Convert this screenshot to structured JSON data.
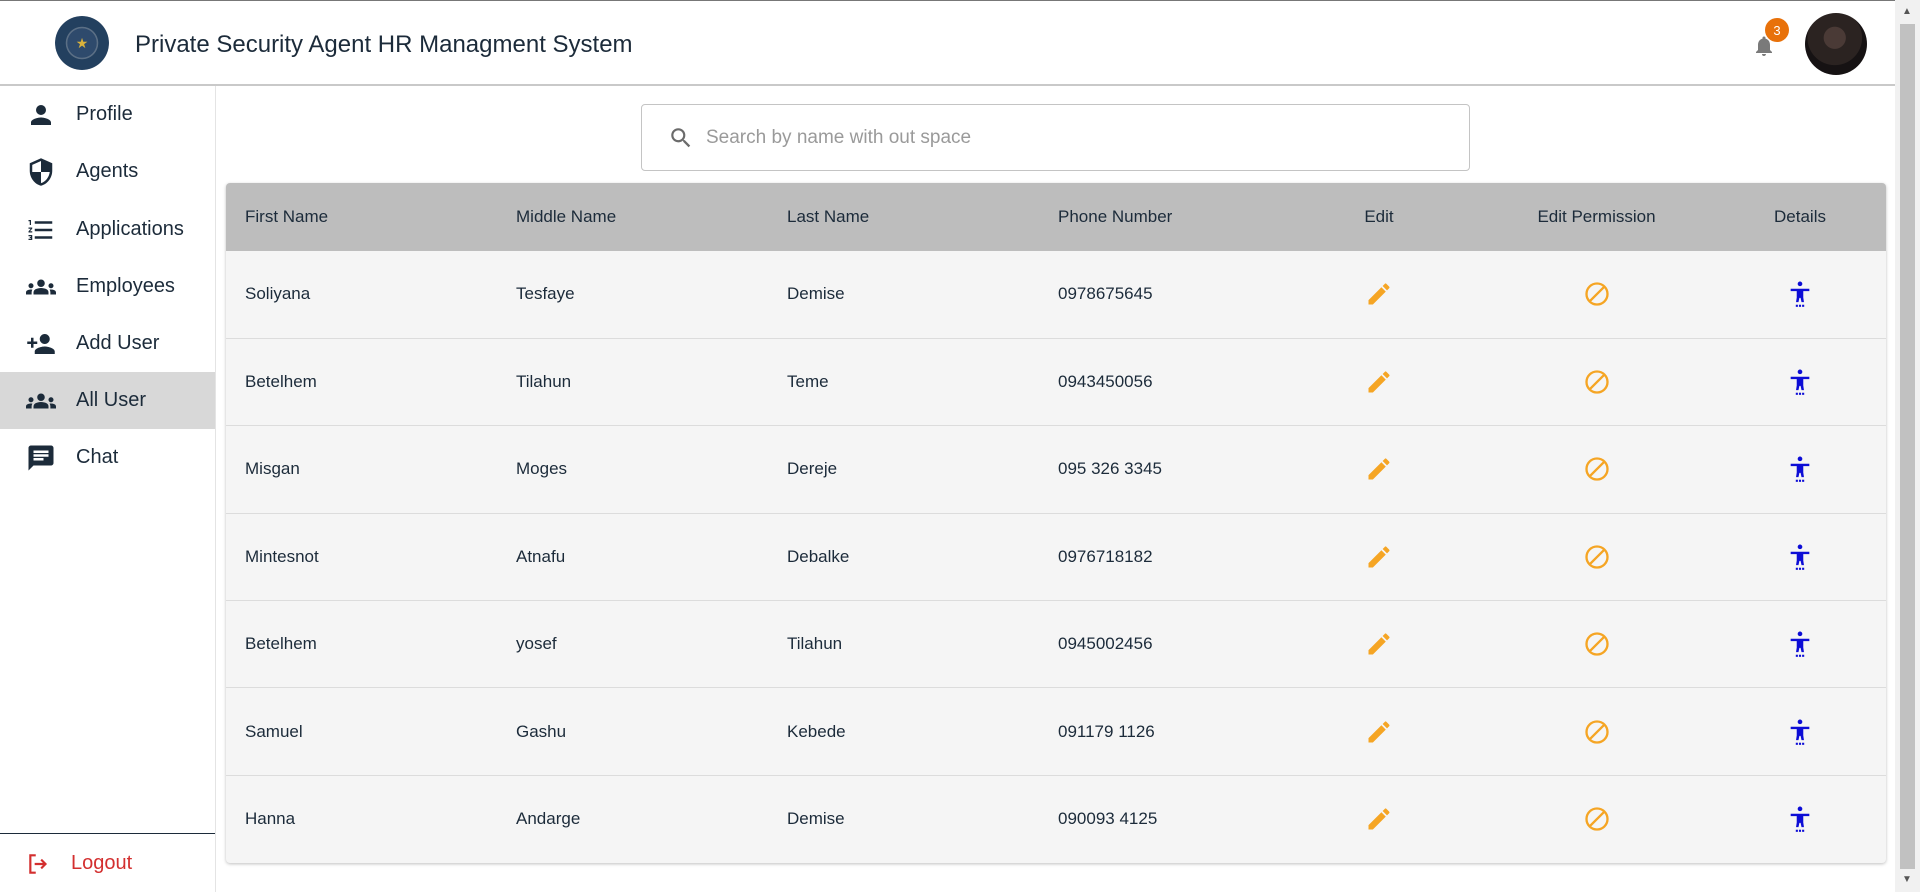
{
  "app": {
    "title": "Private Security Agent HR Managment System"
  },
  "header": {
    "notification_count": "3"
  },
  "sidebar": {
    "items": [
      {
        "label": "Profile",
        "icon": "person-icon"
      },
      {
        "label": "Agents",
        "icon": "shield-icon"
      },
      {
        "label": "Applications",
        "icon": "list-icon"
      },
      {
        "label": "Employees",
        "icon": "group-icon"
      },
      {
        "label": "Add User",
        "icon": "person-add-icon"
      },
      {
        "label": "All User",
        "icon": "group-icon",
        "active": true
      },
      {
        "label": "Chat",
        "icon": "chat-icon"
      }
    ],
    "logout_label": "Logout"
  },
  "search": {
    "placeholder": "Search by name with out space",
    "value": ""
  },
  "table": {
    "headers": [
      "First Name",
      "Middle Name",
      "Last Name",
      "Phone Number",
      "Edit",
      "Edit Permission",
      "Details"
    ],
    "rows": [
      {
        "first": "Soliyana",
        "middle": "Tesfaye",
        "last": "Demise",
        "phone": "0978675645"
      },
      {
        "first": "Betelhem",
        "middle": "Tilahun",
        "last": "Teme",
        "phone": "0943450056"
      },
      {
        "first": "Misgan",
        "middle": "Moges",
        "last": "Dereje",
        "phone": "095 326 3345"
      },
      {
        "first": "Mintesnot",
        "middle": "Atnafu",
        "last": "Debalke",
        "phone": "0976718182"
      },
      {
        "first": "Betelhem",
        "middle": "yosef",
        "last": "Tilahun",
        "phone": "0945002456"
      },
      {
        "first": "Samuel",
        "middle": "Gashu",
        "last": "Kebede",
        "phone": "091179 1126"
      },
      {
        "first": "Hanna",
        "middle": "Andarge",
        "last": "Demise",
        "phone": "090093 4125"
      }
    ]
  },
  "colors": {
    "primary_text": "#1c2b3a",
    "edit_icon": "#f5a524",
    "permission_icon": "#f5a524",
    "details_icon": "#0d0dd6",
    "logout": "#d32f2f",
    "badge": "#e8710a",
    "header_row": "#bdbdbd"
  }
}
